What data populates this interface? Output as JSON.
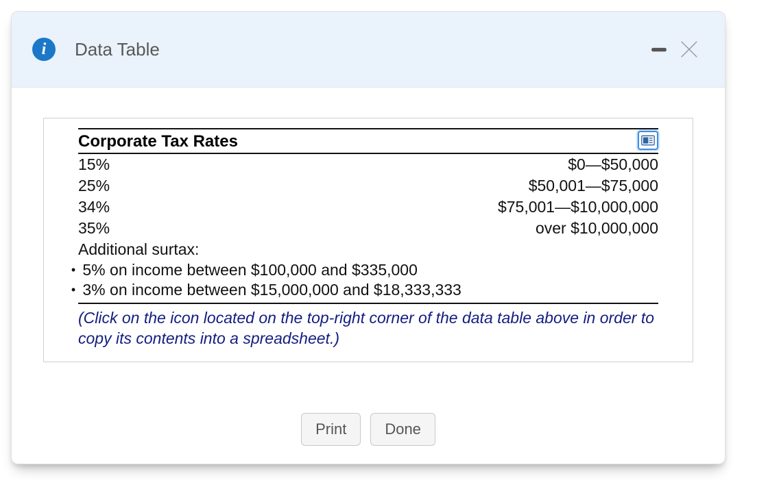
{
  "header": {
    "title": "Data Table"
  },
  "panel": {
    "table_title": "Corporate Tax Rates",
    "rows": [
      {
        "rate": "15%",
        "bracket": "$0—$50,000"
      },
      {
        "rate": "25%",
        "bracket": "$50,001—$75,000"
      },
      {
        "rate": "34%",
        "bracket": "$75,001—$10,000,000"
      },
      {
        "rate": "35%",
        "bracket": "over $10,000,000"
      }
    ],
    "surtax_label": "Additional surtax:",
    "surtax_lines": [
      "5% on income between $100,000 and $335,000",
      "3% on income between $15,000,000 and $18,333,333"
    ],
    "help_note": "(Click on the icon located on the top-right corner of the data table above in order to copy its contents into a spreadsheet.)"
  },
  "footer": {
    "print_label": "Print",
    "done_label": "Done"
  }
}
